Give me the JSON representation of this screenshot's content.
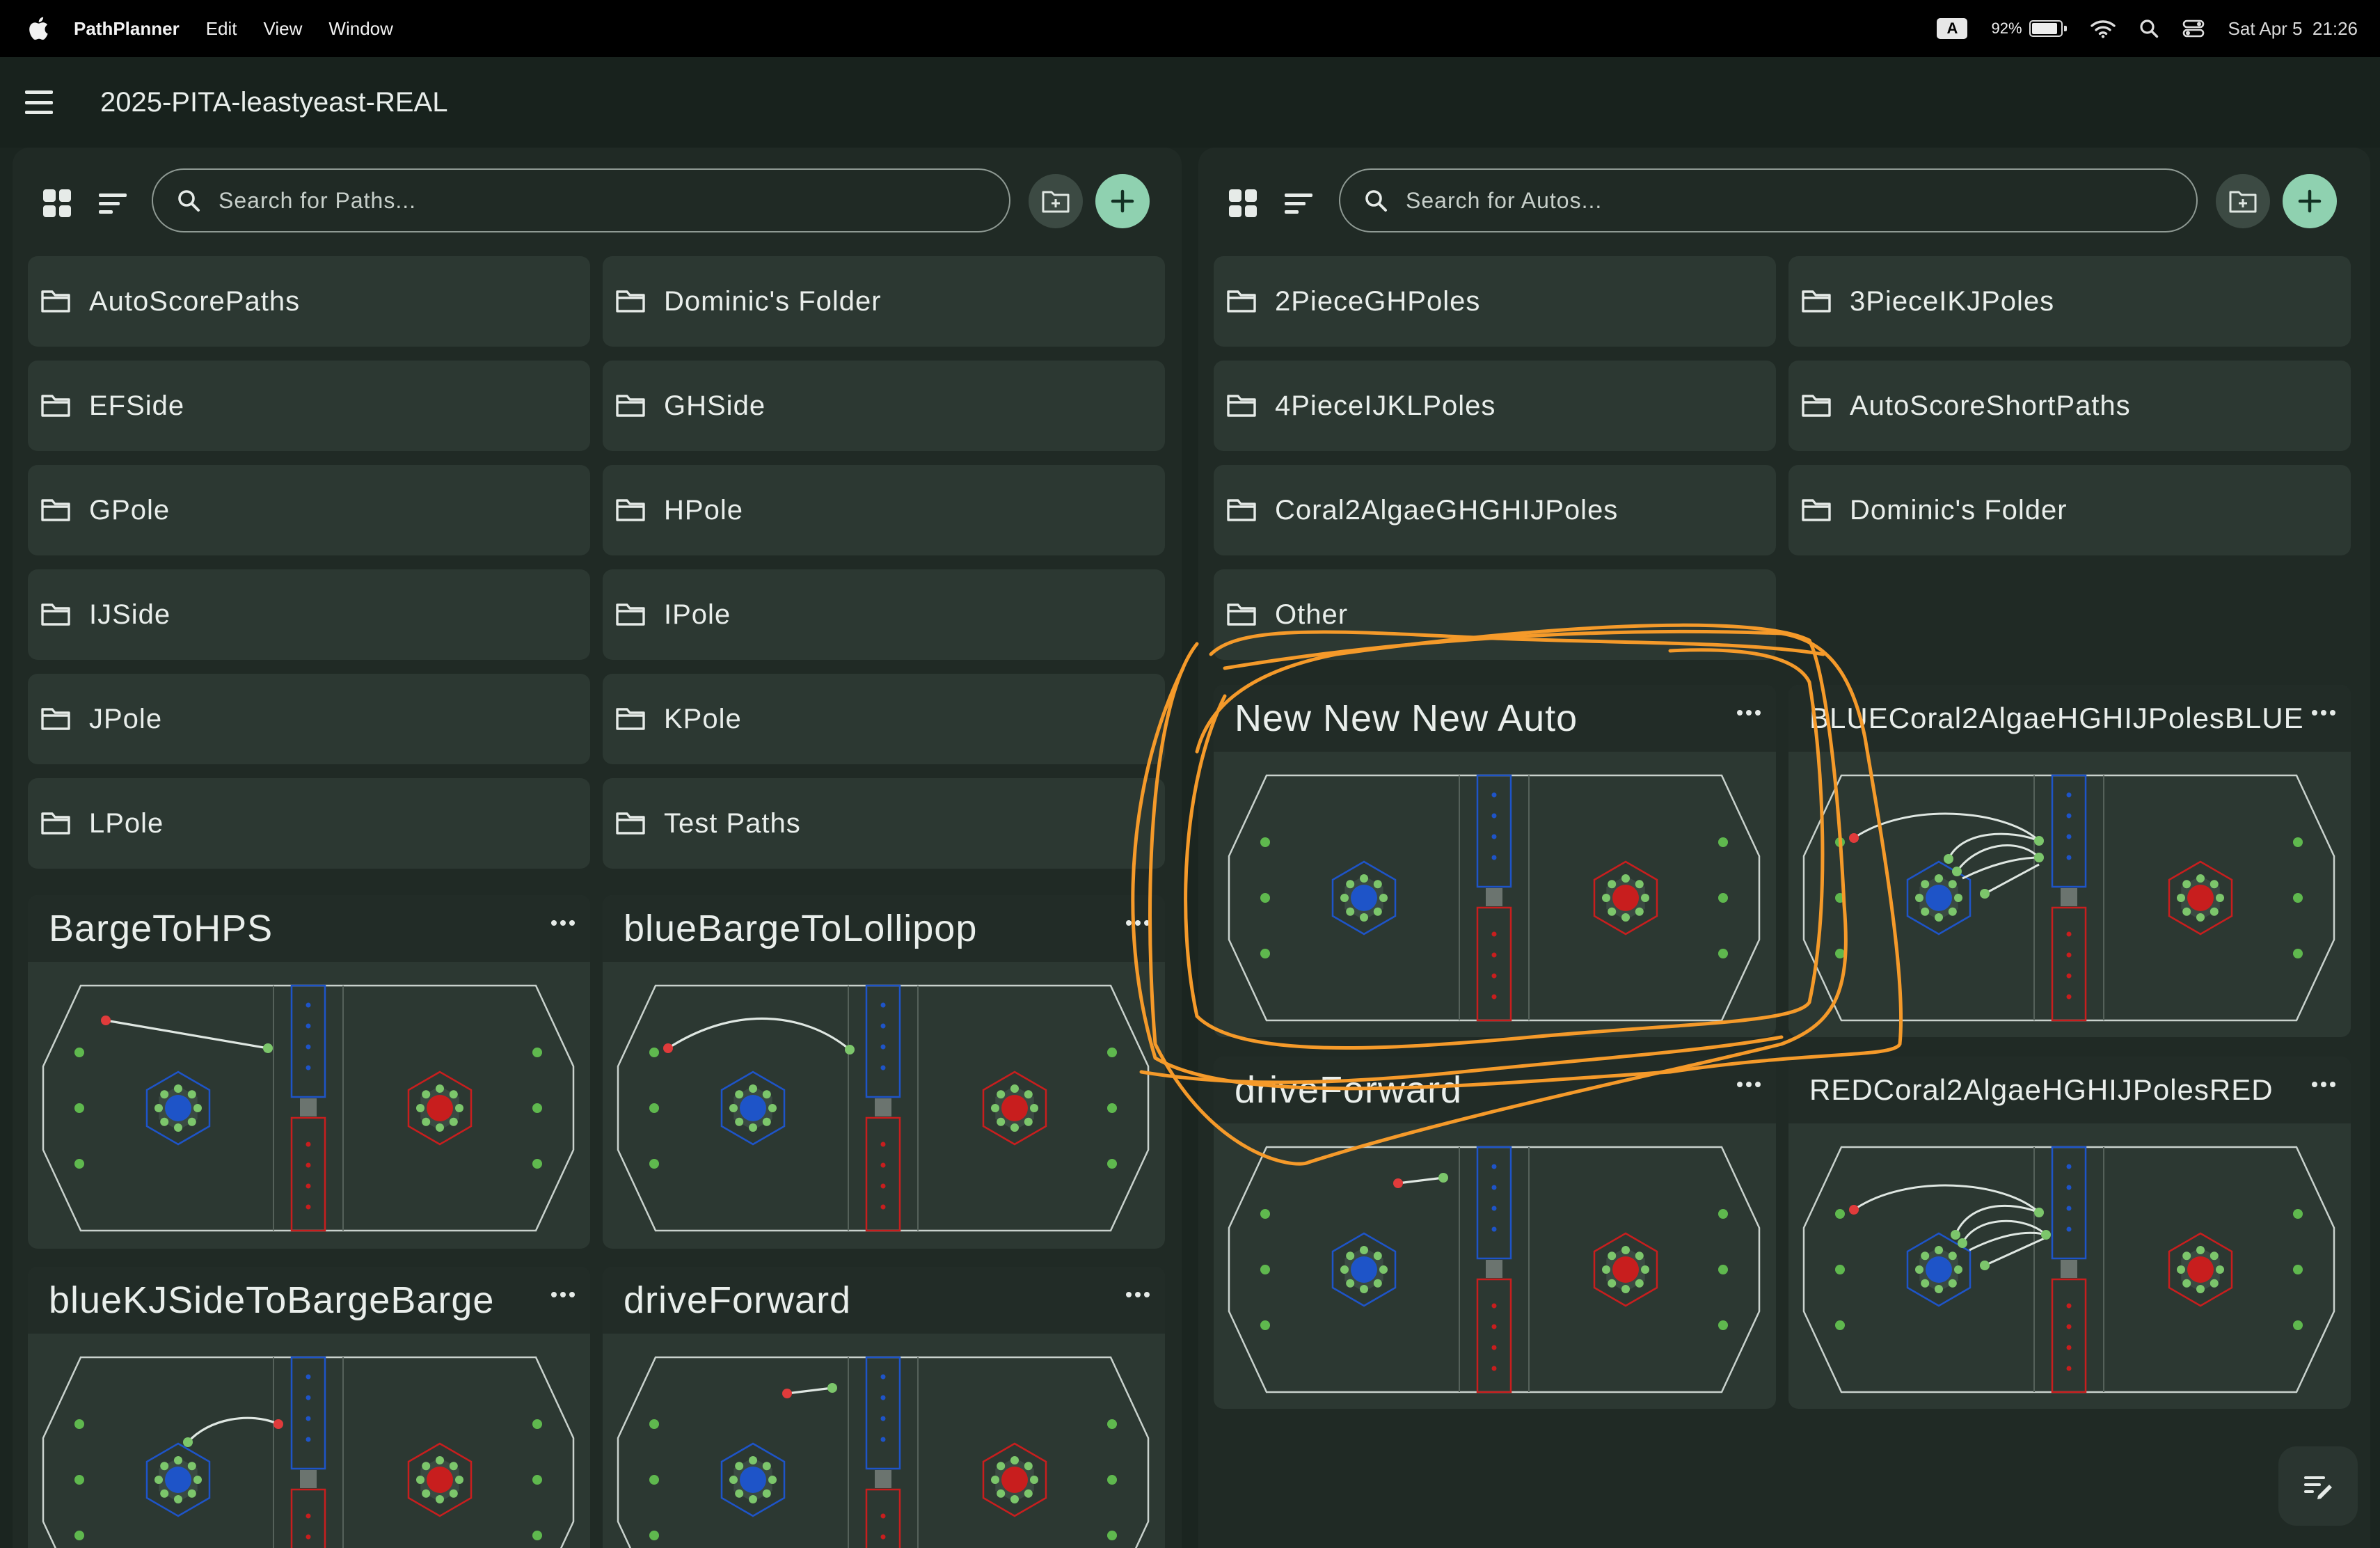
{
  "menubar": {
    "app_name": "PathPlanner",
    "menus": [
      "Edit",
      "View",
      "Window"
    ],
    "input_badge": "A",
    "battery": "92%",
    "battery_level": 0.92,
    "datetime": "Sat Apr 5  21:26"
  },
  "header": {
    "title": "2025-PITA-leastyeast-REAL"
  },
  "paths_panel": {
    "search_placeholder": "Search for Paths...",
    "folders": [
      "AutoScorePaths",
      "Dominic's Folder",
      "EFSide",
      "GHSide",
      "GPole",
      "HPole",
      "IJSide",
      "IPole",
      "JPole",
      "KPole",
      "LPole",
      "Test Paths"
    ],
    "paths": [
      "BargeToHPS",
      "blueBargeToLollipop",
      "blueKJSideToBargeBarge",
      "driveForward"
    ]
  },
  "autos_panel": {
    "search_placeholder": "Search for Autos...",
    "folders": [
      "2PieceGHPoles",
      "3PieceIKJPoles",
      "4PieceIJKLPoles",
      "AutoScoreShortPaths",
      "Coral2AlgaeGHGHIJPoles",
      "Dominic's Folder",
      "Other"
    ],
    "autos": [
      "New New New Auto",
      "BLUECoral2AlgaeHGHIJPolesBLUE",
      "driveForward",
      "REDCoral2AlgaeHGHIJPolesRED"
    ]
  },
  "colors": {
    "background": "#1b2520",
    "panel": "#202a25",
    "card": "#2c3832",
    "accent_add": "#8fd1b0",
    "annotation": "#f59a2a",
    "blue_alliance": "#1e54c8",
    "red_alliance": "#c81e1e"
  }
}
